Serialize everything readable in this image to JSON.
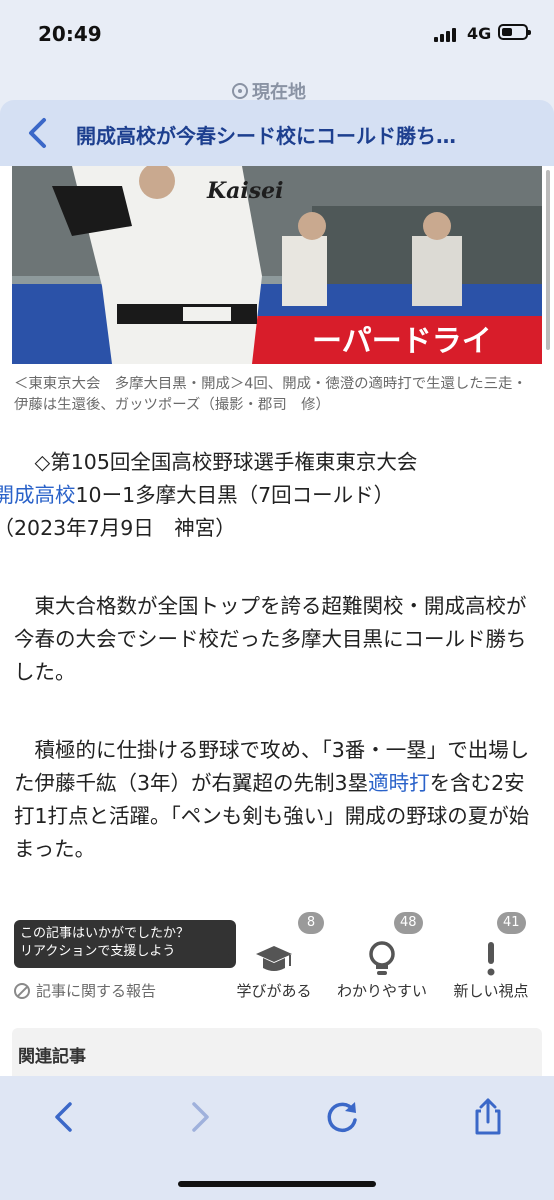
{
  "status_bar": {
    "time": "20:49",
    "network": "4G"
  },
  "location": {
    "label": "現在地"
  },
  "header": {
    "back_glyph": "<",
    "title": "開成高校が今春シード校にコールド勝ち…"
  },
  "article": {
    "caption": "＜東東京大会　多摩大目黒・開成＞4回、開成・徳澄の適時打で生還した三走・伊藤は生還後、ガッツポーズ（撮影・郡司　修）",
    "p1": {
      "line1": "◇第105回全国高校野球選手権東東京大会",
      "team_link": "開成高校",
      "score": "10ー1多摩大目黒（7回コールド）",
      "date": "（2023年7月9日　神宮）"
    },
    "p2": "東大合格数が全国トップを誇る超難関校・開成高校が今春の大会でシード校だった多摩大目黒にコールド勝ちした。",
    "p3": {
      "before": "積極的に仕掛ける野球で攻め、「3番・一塁」で出場した伊藤千紘（3年）が右翼超の先制3塁",
      "link": "適時打",
      "after": "を含む2安打1打点と活躍。「ペンも剣も強い」開成の野球の夏が始まった。"
    }
  },
  "reactions": {
    "prompt": "この記事はいかがでしたか？\nリアクションで支援しよう",
    "report": "記事に関する報告",
    "items": [
      {
        "icon": "graduation-cap-icon",
        "label": "学びがある",
        "count": "8"
      },
      {
        "icon": "lightbulb-icon",
        "label": "わかりやすい",
        "count": "48"
      },
      {
        "icon": "exclamation-icon",
        "label": "新しい視点",
        "count": "41"
      }
    ]
  },
  "related": {
    "title": "関連記事"
  },
  "toolbar": {
    "buttons": [
      "back-icon",
      "forward-icon",
      "reload-icon",
      "share-icon"
    ]
  },
  "colors": {
    "accent": "#3b68c8",
    "link": "#2a62c9",
    "header_bg": "#d5e0f3",
    "toolbar_bg": "#dfe6f4"
  }
}
